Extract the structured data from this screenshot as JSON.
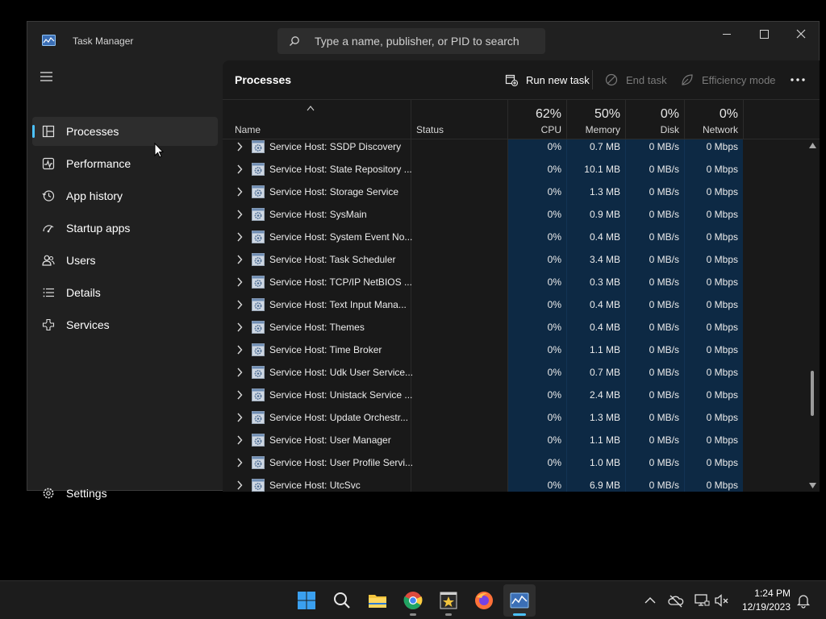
{
  "window": {
    "title": "Task Manager",
    "search_placeholder": "Type a name, publisher, or PID to search"
  },
  "sidebar": {
    "items": [
      {
        "label": "Processes",
        "icon": "processes-icon",
        "active": true
      },
      {
        "label": "Performance",
        "icon": "performance-icon"
      },
      {
        "label": "App history",
        "icon": "history-icon"
      },
      {
        "label": "Startup apps",
        "icon": "startup-icon"
      },
      {
        "label": "Users",
        "icon": "users-icon"
      },
      {
        "label": "Details",
        "icon": "details-icon"
      },
      {
        "label": "Services",
        "icon": "services-icon"
      }
    ],
    "settings_label": "Settings"
  },
  "main": {
    "title": "Processes",
    "toolbar": {
      "run_new_task": "Run new task",
      "end_task": "End task",
      "efficiency_mode": "Efficiency mode"
    },
    "columns": {
      "name": "Name",
      "status": "Status",
      "cpu": {
        "pct": "62%",
        "label": "CPU"
      },
      "memory": {
        "pct": "50%",
        "label": "Memory"
      },
      "disk": {
        "pct": "0%",
        "label": "Disk"
      },
      "network": {
        "pct": "0%",
        "label": "Network"
      }
    },
    "rows": [
      {
        "name": "Service Host: SSDP Discovery",
        "cpu": "0%",
        "memory": "0.7 MB",
        "disk": "0 MB/s",
        "network": "0 Mbps"
      },
      {
        "name": "Service Host: State Repository ...",
        "cpu": "0%",
        "memory": "10.1 MB",
        "disk": "0 MB/s",
        "network": "0 Mbps"
      },
      {
        "name": "Service Host: Storage Service",
        "cpu": "0%",
        "memory": "1.3 MB",
        "disk": "0 MB/s",
        "network": "0 Mbps"
      },
      {
        "name": "Service Host: SysMain",
        "cpu": "0%",
        "memory": "0.9 MB",
        "disk": "0 MB/s",
        "network": "0 Mbps"
      },
      {
        "name": "Service Host: System Event No...",
        "cpu": "0%",
        "memory": "0.4 MB",
        "disk": "0 MB/s",
        "network": "0 Mbps"
      },
      {
        "name": "Service Host: Task Scheduler",
        "cpu": "0%",
        "memory": "3.4 MB",
        "disk": "0 MB/s",
        "network": "0 Mbps"
      },
      {
        "name": "Service Host: TCP/IP NetBIOS ...",
        "cpu": "0%",
        "memory": "0.3 MB",
        "disk": "0 MB/s",
        "network": "0 Mbps"
      },
      {
        "name": "Service Host: Text Input Mana...",
        "cpu": "0%",
        "memory": "0.4 MB",
        "disk": "0 MB/s",
        "network": "0 Mbps"
      },
      {
        "name": "Service Host: Themes",
        "cpu": "0%",
        "memory": "0.4 MB",
        "disk": "0 MB/s",
        "network": "0 Mbps"
      },
      {
        "name": "Service Host: Time Broker",
        "cpu": "0%",
        "memory": "1.1 MB",
        "disk": "0 MB/s",
        "network": "0 Mbps"
      },
      {
        "name": "Service Host: Udk User Service...",
        "cpu": "0%",
        "memory": "0.7 MB",
        "disk": "0 MB/s",
        "network": "0 Mbps"
      },
      {
        "name": "Service Host: Unistack Service ...",
        "cpu": "0%",
        "memory": "2.4 MB",
        "disk": "0 MB/s",
        "network": "0 Mbps"
      },
      {
        "name": "Service Host: Update Orchestr...",
        "cpu": "0%",
        "memory": "1.3 MB",
        "disk": "0 MB/s",
        "network": "0 Mbps"
      },
      {
        "name": "Service Host: User Manager",
        "cpu": "0%",
        "memory": "1.1 MB",
        "disk": "0 MB/s",
        "network": "0 Mbps"
      },
      {
        "name": "Service Host: User Profile Servi...",
        "cpu": "0%",
        "memory": "1.0 MB",
        "disk": "0 MB/s",
        "network": "0 Mbps"
      },
      {
        "name": "Service Host: UtcSvc",
        "cpu": "0%",
        "memory": "6.9 MB",
        "disk": "0 MB/s",
        "network": "0 Mbps"
      }
    ]
  },
  "taskbar": {
    "apps": [
      "start-icon",
      "search-icon",
      "file-explorer-icon",
      "chrome-icon",
      "movie-maker-icon",
      "firefox-icon",
      "task-manager-icon"
    ],
    "clock_time": "1:24 PM",
    "clock_date": "12/19/2023"
  },
  "colors": {
    "accent": "#4cc2ff",
    "highlight_column": "#0d2944",
    "window_bg": "#202020",
    "content_bg": "#191919"
  }
}
